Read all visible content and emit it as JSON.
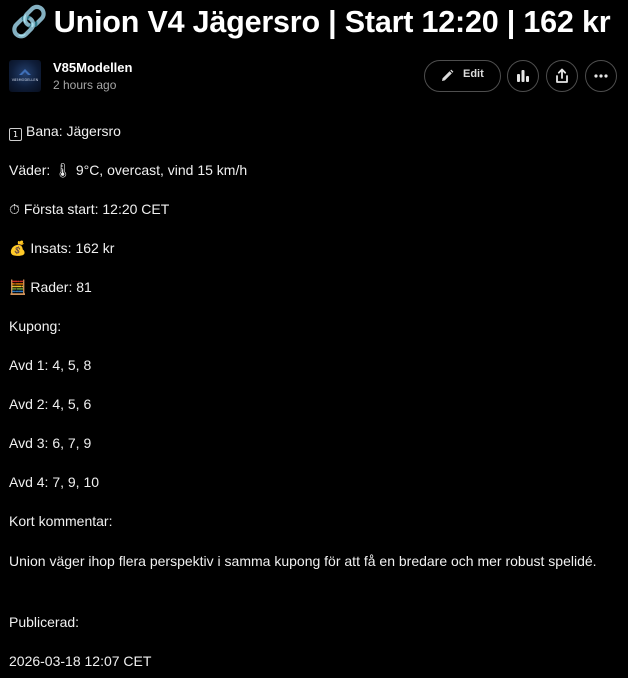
{
  "post": {
    "title_icon": "🔗",
    "title": "Union V4 Jägersro | Start 12:20 | 162 kr"
  },
  "author": {
    "avatar_text": "V85MODELLEN",
    "name": "V85Modellen",
    "time": "2 hours ago"
  },
  "actions": {
    "edit_label": "Edit",
    "edit_icon": "pencil-icon",
    "stats_icon": "bar-chart-icon",
    "share_icon": "share-icon",
    "more_icon": "more-horizontal-icon"
  },
  "content": {
    "track_icon": "1",
    "track": "Bana: Jägersro",
    "weather_prefix": "Väder:",
    "weather_icon": "🌡",
    "weather": "9°C, overcast, vind 15 km/h",
    "start_icon": "⏱",
    "start": "Första start: 12:20 CET",
    "stake_icon": "💰",
    "stake": "Insats: 162 kr",
    "rows_icon": "🧮",
    "rows": "Rader: 81",
    "coupon_heading": "Kupong:",
    "legs": [
      "Avd 1: 4, 5, 8",
      "Avd 2: 4, 5, 6",
      "Avd 3: 6, 7, 9",
      "Avd 4: 7, 9, 10"
    ],
    "comment_heading": "Kort kommentar:",
    "comment": "Union väger ihop flera perspektiv i samma kupong för att få en bredare och mer robust spelidé.",
    "published_heading": "Publicerad:",
    "published": "2026-03-18 12:07 CET"
  },
  "colors": {
    "background": "#000000",
    "text": "#ffffff",
    "muted": "#a6a6a6",
    "button_border": "#4e4e4e"
  }
}
